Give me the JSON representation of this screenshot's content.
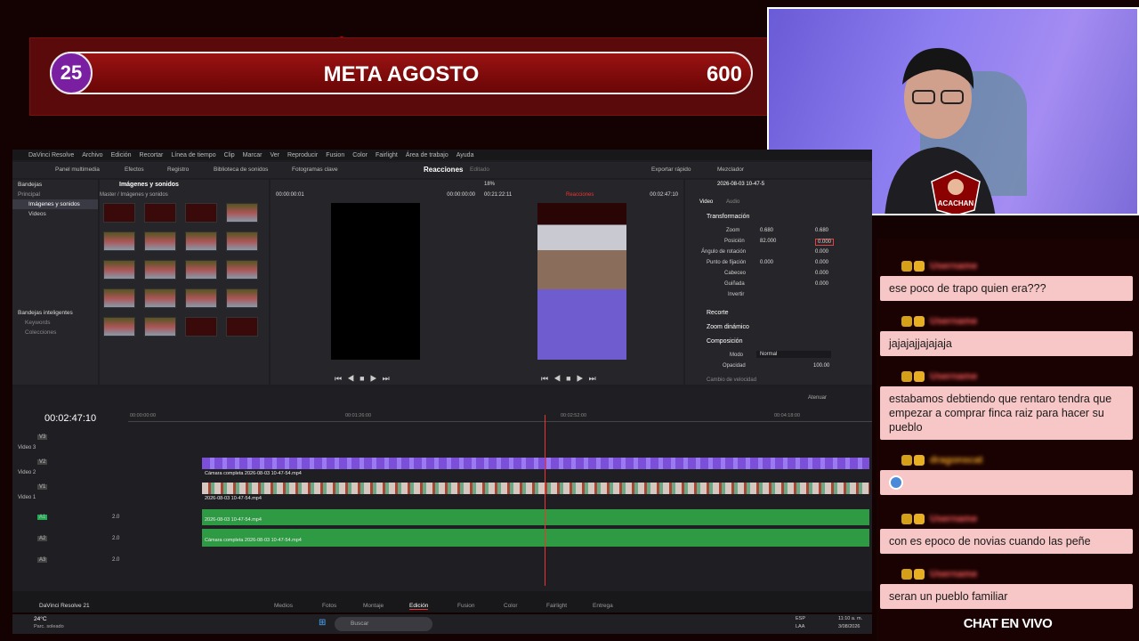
{
  "goal": {
    "start": "25",
    "title": "META AGOSTO",
    "end": "600"
  },
  "resolve": {
    "menu": [
      "DaVinci Resolve",
      "Archivo",
      "Edición",
      "Recortar",
      "Línea de tiempo",
      "Clip",
      "Marcar",
      "Ver",
      "Reproducir",
      "Fusion",
      "Color",
      "Fairlight",
      "Área de trabajo",
      "Ayuda"
    ],
    "toolbar": {
      "media_pool": "Panel multimedia",
      "effects": "Efectos",
      "log": "Registro",
      "sound_library": "Biblioteca de sonidos",
      "keyframes": "Fotogramas clave",
      "project_title": "Reacciones",
      "status": "Editado",
      "quick_export": "Exportar rápido",
      "mixer": "Mezclador"
    },
    "bins": {
      "header": "Bandejas",
      "master": "Principal",
      "items": [
        "Imágenes y sonidos",
        "Videos"
      ],
      "smart_header": "Bandejas inteligentes",
      "smart_items": [
        "Keywords",
        "Colecciones"
      ]
    },
    "media": {
      "title": "Imágenes y sonidos",
      "path": "Master / Imágenes y sonidos",
      "zoom": "18%"
    },
    "viewer1": {
      "timecode": "00:00:00:01",
      "tc2": "00:00:00:00"
    },
    "viewer2": {
      "zoom": "18%",
      "timecode": "00:21:22:11",
      "label": "Reacciones",
      "tc": "00:02:47:10"
    },
    "inspector": {
      "clip": "2026-08-03 10-47-5",
      "tabs": [
        "Video",
        "Audio"
      ],
      "section": "Transformación",
      "zoom_label": "Zoom",
      "zoom_x": "0.680",
      "zoom_y": "0.680",
      "pos_label": "Posición",
      "pos_x": "82.000",
      "pos_y": "0.000",
      "rot_label": "Ángulo de rotación",
      "rot": "0.000",
      "anchor_label": "Punto de fijación",
      "anchor_x": "0.000",
      "anchor_y": "0.000",
      "pitch_label": "Cabeceo",
      "pitch": "0.000",
      "yaw_label": "Guiñada",
      "yaw": "0.000",
      "flip_label": "Invertir",
      "crop": "Recorte",
      "dyn_zoom": "Zoom dinámico",
      "composite": "Composición",
      "mode_label": "Modo",
      "mode": "Normal",
      "opacity_label": "Opacidad",
      "opacity": "100.00",
      "speed": "Cambio de velocidad"
    },
    "timeline": {
      "timecode": "00:02:47:10",
      "ruler": [
        "00:00:00:00",
        "00:01:26:00",
        "00:02:52:00",
        "00:04:18:00"
      ],
      "attenuate": "Atenuar",
      "tracks": [
        {
          "id": "V3",
          "name": "Video 3"
        },
        {
          "id": "V2",
          "name": "Video 2"
        },
        {
          "id": "V1",
          "name": "Video 1"
        },
        {
          "id": "A1",
          "name": "",
          "level": "2.0"
        },
        {
          "id": "A2",
          "name": "",
          "level": "2.0"
        },
        {
          "id": "A3",
          "name": "",
          "level": "2.0"
        }
      ],
      "clips": {
        "v2": "Cámara completa 2026-08-03 10-47-54.mp4",
        "v1": "2026-08-03 10-47-54.mp4",
        "a1": "2026-08-03 10-47-54.mp4",
        "a2": "Cámara completa 2026-08-03 10-47-54.mp4"
      }
    },
    "pages": [
      "Medios",
      "Fotos",
      "Montaje",
      "Edición",
      "Fusion",
      "Color",
      "Fairlight",
      "Entrega"
    ],
    "active_page": "Edición",
    "brand": "DaVinci Resolve 21"
  },
  "taskbar": {
    "weather": "24°C",
    "weather_desc": "Parc. soleado",
    "search": "Buscar",
    "lang1": "ESP",
    "lang2": "LAA",
    "time": "11:10 a. m.",
    "date": "3/08/2026"
  },
  "chat": {
    "messages": [
      {
        "name": "Username",
        "text": "ese poco de trapo quien era???"
      },
      {
        "name": "Username",
        "text": "jajajajjajajaja"
      },
      {
        "name": "Username",
        "text": "estabamos debtiendo que rentaro tendra que empezar a comprar finca raiz para hacer su pueblo"
      },
      {
        "name": "dragonscat",
        "text": ""
      },
      {
        "name": "Username",
        "text": "con es epoco de novias cuando las peñe"
      },
      {
        "name": "Username",
        "text": "seran un pueblo familiar"
      }
    ],
    "footer": "CHAT EN VIVO"
  },
  "cam": {
    "logo": "ACACHAN"
  }
}
